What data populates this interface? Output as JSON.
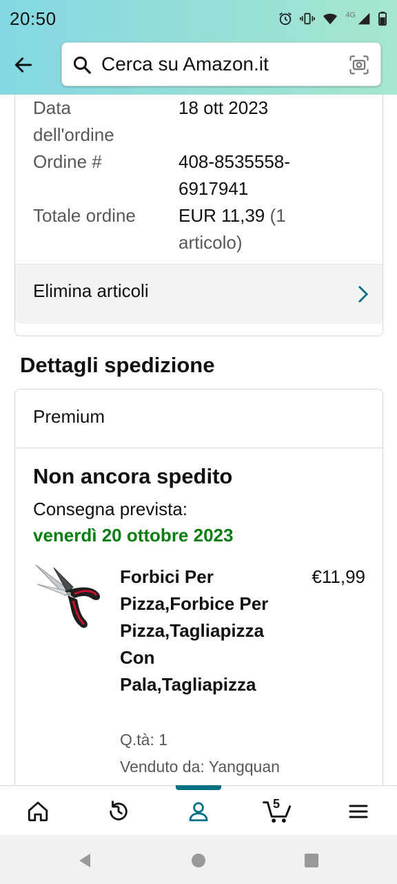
{
  "status_bar": {
    "time": "20:50",
    "network": "4G"
  },
  "search": {
    "placeholder": "Cerca su Amazon.it"
  },
  "order": {
    "date_label": "Data dell'ordine",
    "date_value": "18 ott 2023",
    "number_label": "Ordine #",
    "number_value": "408-8535558-6917941",
    "total_label": "Totale ordine",
    "total_value": "EUR 11,39",
    "total_items": "(1 articolo)",
    "delete_label": "Elimina articoli"
  },
  "shipping": {
    "section_title": "Dettagli spedizione",
    "service": "Premium",
    "status": "Non ancora spedito",
    "delivery_label": "Consegna prevista:",
    "delivery_date": "venerdì 20 ottobre 2023",
    "accent_color": "#067d0f"
  },
  "product": {
    "title": "Forbici Per Pizza,Forbice Per Pizza,Tagliapizza Con Pala,Tagliapizza",
    "price": "€11,99",
    "quantity": "Q.tà: 1",
    "seller": "Venduto da: Yangquan"
  },
  "bottom_nav": {
    "items": [
      "home-icon",
      "history-icon",
      "account-icon",
      "cart-icon",
      "menu-icon"
    ],
    "active": "account-icon",
    "cart_count": "5",
    "accent_color": "#007185"
  }
}
